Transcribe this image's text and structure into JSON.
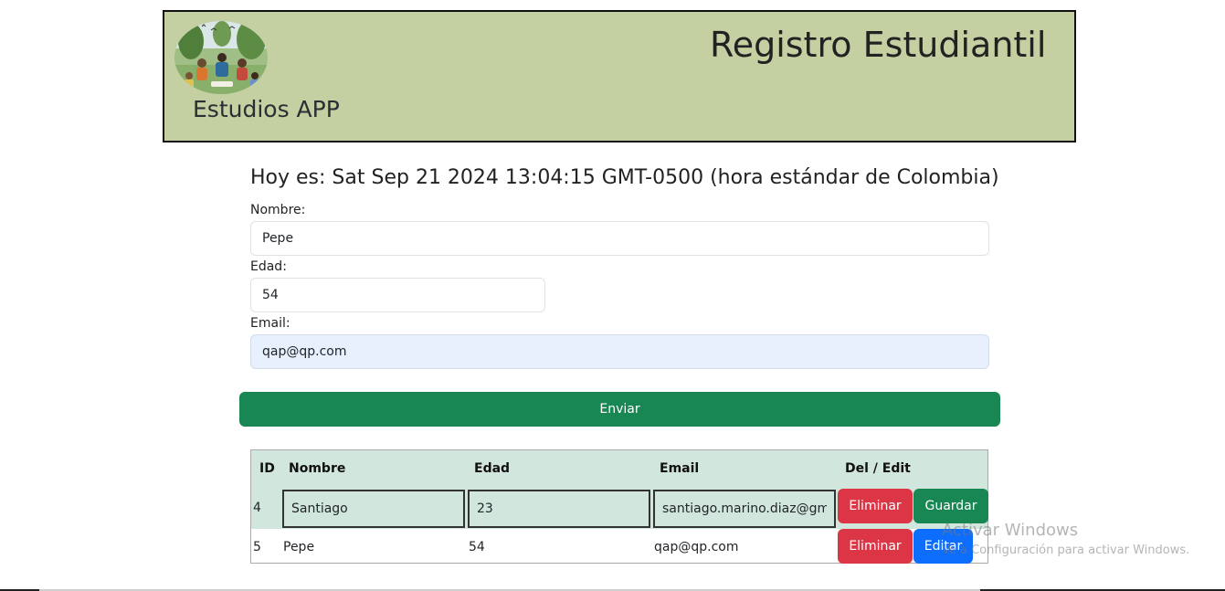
{
  "header": {
    "app_name": "Estudios APP",
    "title": "Registro Estudiantil",
    "background": "#c4cfa2"
  },
  "date_line": "Hoy es: Sat Sep 21 2024 13:04:15 GMT-0500 (hora estándar de Colombia)",
  "form": {
    "nombre_label": "Nombre:",
    "nombre_value": "Pepe",
    "edad_label": "Edad:",
    "edad_value": "54",
    "email_label": "Email:",
    "email_value": "qap@qp.com",
    "submit_label": "Enviar"
  },
  "table": {
    "headers": [
      "ID",
      "Nombre",
      "Edad",
      "Email",
      "Del / Edit"
    ],
    "rows": [
      {
        "id": "4",
        "nombre": "Santiago",
        "edad": "23",
        "email": "santiago.marino.diaz@gm",
        "delete_label": "Eliminar",
        "action_label": "Guardar",
        "editing": true
      },
      {
        "id": "5",
        "nombre": "Pepe",
        "edad": "54",
        "email": "qap@qp.com",
        "delete_label": "Eliminar",
        "action_label": "Editar",
        "editing": false
      }
    ]
  },
  "watermark": {
    "title": "Activar Windows",
    "subtitle": "Ve a Configuración para activar Windows."
  },
  "colors": {
    "primary": "#0d6efd",
    "success": "#198754",
    "danger": "#dc3545",
    "table_header": "#d1e7dd"
  }
}
